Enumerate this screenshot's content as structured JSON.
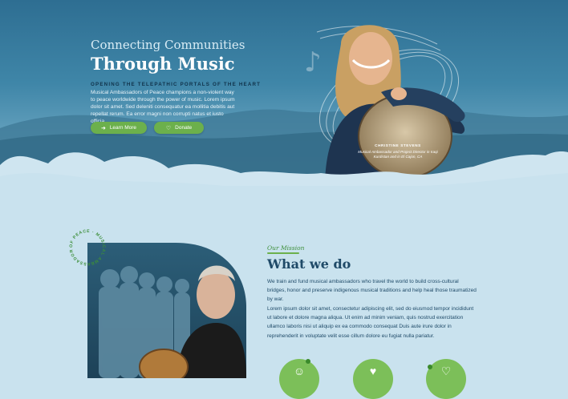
{
  "hero": {
    "subtitle": "Connecting Communities",
    "title": "Through Music",
    "kicker": "OPENING THE TELEPATHIC PORTALS OF THE HEART",
    "body": "Musical Ambassadors of Peace champions a non-violent way to peace worldwide through the power of music. Lorem ipsum dolor sit amet. Sed deleniti consequatur ea mollitia debitis aut repellat rerum. Ea error magni non corrupti natus et iusto officia.",
    "learn_more": "Learn More",
    "donate": "Donate",
    "caption_name": "CHRISTINE STEVENS",
    "caption_role": "Musical Ambassador and Project Director in Iraqi Kurdistan and in El Cajon, CA"
  },
  "mission": {
    "badge_text": "OF PEACE · MUSICAL AMBASSADORS",
    "label": "Our Mission",
    "title": "What we do",
    "paragraph1": "We train and fund musical ambassadors who travel the world to build cross-cultural bridges, honor and preserve indigenous musical traditions and help heal those traumatized by war.",
    "paragraph2": "Lorem ipsum dolor sit amet, consectetur adipiscing elit, sed do eiusmod tempor incididunt ut labore et dolore magna aliqua. Ut enim ad minim veniam, quis nostrud exercitation ullamco laboris nisi ut aliquip ex ea commodo consequat Duis aute irure dolor in reprehenderit in voluptate velit esse cillum dolore eu fugiat nulla pariatur."
  },
  "colors": {
    "accent_green": "#6cb04c",
    "navy_text": "#1f4a68",
    "hero_blue": "#3f86a8"
  },
  "icons": [
    "music-note-icon",
    "arrow-right-icon",
    "heart-icon",
    "community-icon",
    "hands-heart-icon",
    "heart-outline-icon"
  ]
}
